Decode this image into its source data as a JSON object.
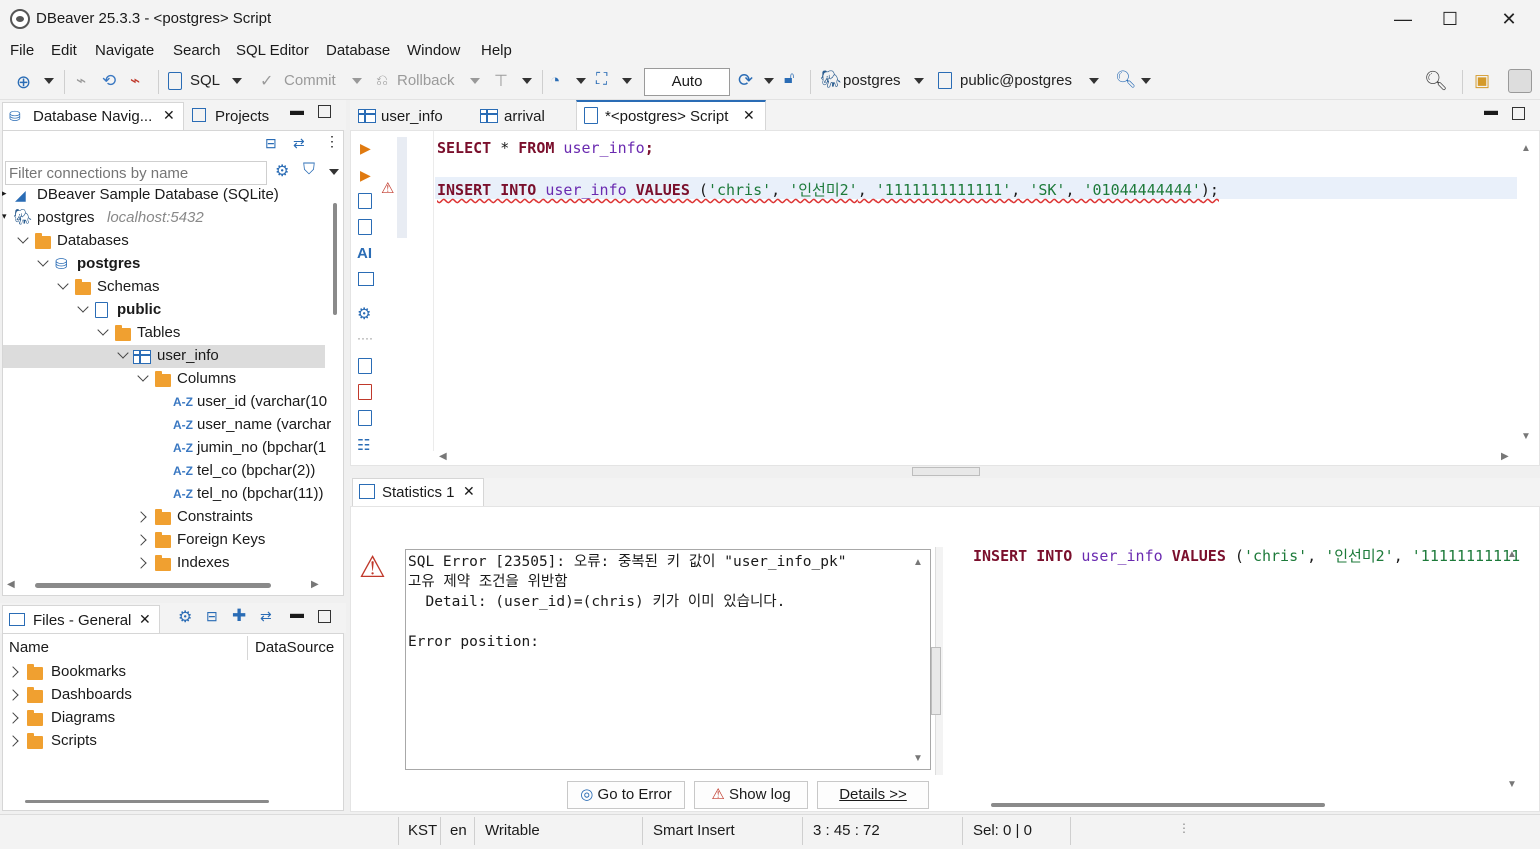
{
  "window": {
    "title": "DBeaver 25.3.3 - <postgres> Script",
    "minimize": "—",
    "maximize": "☐",
    "close": "✕"
  },
  "menu": [
    "File",
    "Edit",
    "Navigate",
    "Search",
    "SQL Editor",
    "Database",
    "Window",
    "Help"
  ],
  "toolbar": {
    "sql_label": "SQL",
    "commit_label": "Commit",
    "rollback_label": "Rollback",
    "transaction_mode": "Auto",
    "connection": "postgres",
    "schema": "public@postgres"
  },
  "navigator": {
    "tab_label": "Database Navig...",
    "projects_label": "Projects",
    "filter_placeholder": "Filter connections by name",
    "tree": {
      "sample_db": "DBeaver Sample Database (SQLite)",
      "postgres": "postgres",
      "postgres_host": "localhost:5432",
      "databases": "Databases",
      "db_postgres": "postgres",
      "schemas": "Schemas",
      "public": "public",
      "tables": "Tables",
      "user_info": "user_info",
      "columns": "Columns",
      "col_user_id": "user_id (varchar(10",
      "col_user_name": "user_name (varchar",
      "col_jumin_no": "jumin_no (bpchar(1",
      "col_tel_co": "tel_co (bpchar(2))",
      "col_tel_no": "tel_no (bpchar(11))",
      "constraints": "Constraints",
      "foreign_keys": "Foreign Keys",
      "indexes": "Indexes"
    }
  },
  "files_panel": {
    "tab_label": "Files - General",
    "col_name": "Name",
    "col_datasource": "DataSource",
    "items": [
      "Bookmarks",
      "Dashboards",
      "Diagrams",
      "Scripts"
    ]
  },
  "editor": {
    "tabs": [
      "user_info",
      "arrival",
      "*<postgres> Script"
    ],
    "line1": {
      "kw_select": "SELECT",
      "star": " * ",
      "kw_from": "FROM",
      "table": " user_info",
      "end": ";"
    },
    "line2": {
      "kw_insert": "INSERT",
      "kw_into": "INTO",
      "table": "user_info",
      "kw_values": "VALUES",
      "open": " (",
      "v1": "'chris'",
      "v2": "'인선미2'",
      "v3": "'1111111111111'",
      "v4": "'SK'",
      "v5": "'01044444444'",
      "close": ");"
    }
  },
  "results": {
    "tab_label": "Statistics 1",
    "error_text": "SQL Error [23505]: 오류: 중복된 키 값이 \"user_info_pk\"\n고유 제약 조건을 위반함\n  Detail: (user_id)=(chris) 키가 이미 있습니다.\n\nError position:",
    "go_to_error": "Go to Error",
    "show_log": "Show log",
    "details": "Details >>",
    "preview": {
      "kw_insert": "INSERT",
      "kw_into": "INTO",
      "table": "user_info",
      "kw_values": "VALUES",
      "open": " (",
      "v1": "'chris'",
      "v2": "'인선미2'",
      "v3": "'11111111111"
    }
  },
  "status": {
    "timezone": "KST",
    "locale": "en",
    "mode": "Writable",
    "insert_mode": "Smart Insert",
    "position": "3 : 45 : 72",
    "selection": "Sel: 0 | 0"
  }
}
